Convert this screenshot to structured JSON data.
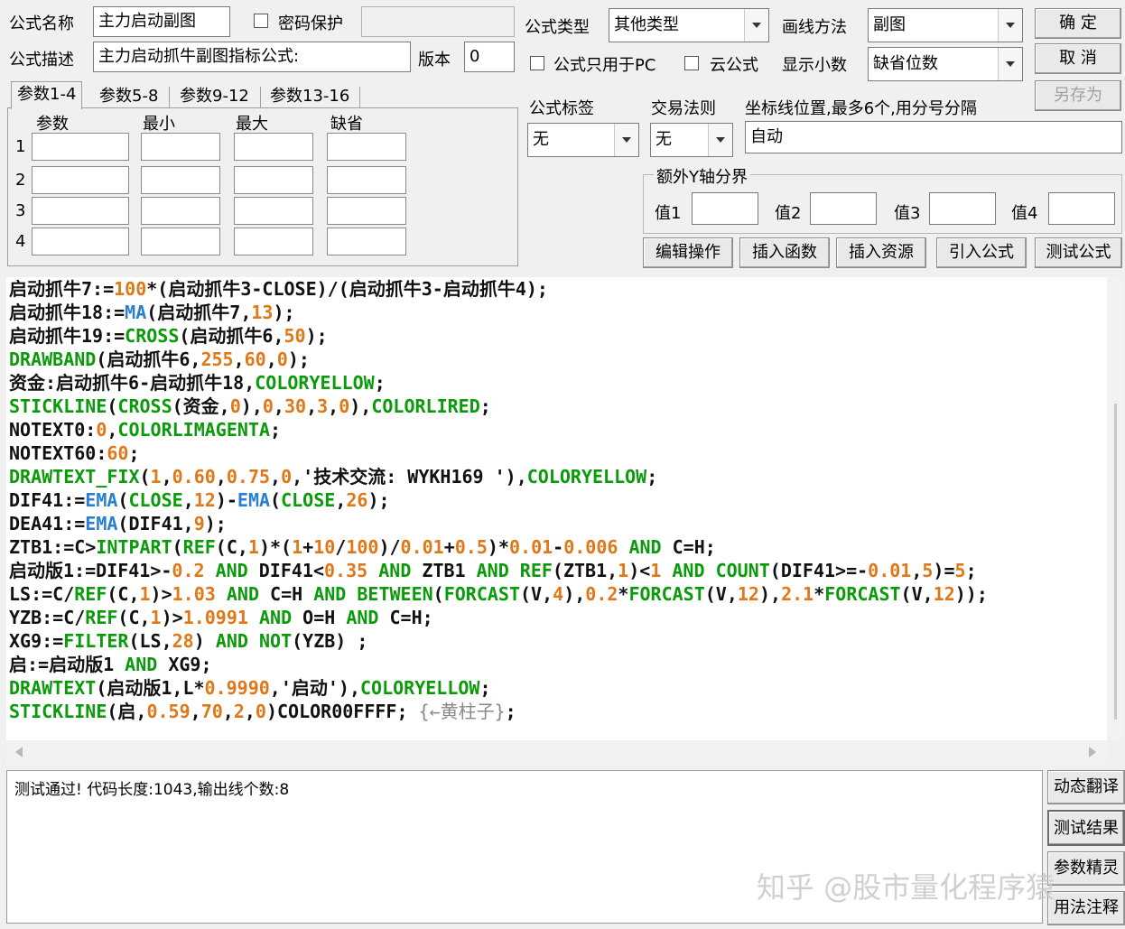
{
  "top": {
    "name_label": "公式名称",
    "name_value": "主力启动副图",
    "password_label": "密码保护",
    "desc_label": "公式描述",
    "desc_value": "主力启动抓牛副图指标公式:",
    "version_label": "版本",
    "version_value": "0",
    "type_label": "公式类型",
    "type_value": "其他类型",
    "draw_label": "画线方法",
    "draw_value": "副图",
    "pc_only_label": "公式只用于PC",
    "cloud_label": "云公式",
    "decimal_label": "显示小数",
    "decimal_value": "缺省位数",
    "ok_button": "确 定",
    "cancel_button": "取 消",
    "saveas_button": "另存为"
  },
  "tabs": [
    "参数1-4",
    "参数5-8",
    "参数9-12",
    "参数13-16"
  ],
  "params": {
    "headers": [
      "参数",
      "最小",
      "最大",
      "缺省"
    ],
    "rows": [
      "1",
      "2",
      "3",
      "4"
    ]
  },
  "right": {
    "tag_label": "公式标签",
    "tag_value": "无",
    "rule_label": "交易法则",
    "rule_value": "无",
    "axis_label": "坐标线位置,最多6个,用分号分隔",
    "axis_value": "自动",
    "yaxis_group": "额外Y轴分界",
    "v1": "值1",
    "v2": "值2",
    "v3": "值3",
    "v4": "值4"
  },
  "actions": [
    "编辑操作",
    "插入函数",
    "插入资源",
    "引入公式",
    "测试公式"
  ],
  "code": [
    [
      [
        "k",
        "启动抓牛7:="
      ],
      [
        "o",
        "100"
      ],
      [
        "k",
        "*(启动抓牛3-CLOSE)/(启动抓牛3-启动抓牛4);"
      ]
    ],
    [
      [
        "k",
        "启动抓牛18:="
      ],
      [
        "b",
        "MA"
      ],
      [
        "k",
        "(启动抓牛7,"
      ],
      [
        "o",
        "13"
      ],
      [
        "k",
        ");"
      ]
    ],
    [
      [
        "k",
        "启动抓牛19:="
      ],
      [
        "g",
        "CROSS"
      ],
      [
        "k",
        "(启动抓牛6,"
      ],
      [
        "o",
        "50"
      ],
      [
        "k",
        ");"
      ]
    ],
    [
      [
        "g",
        "DRAWBAND"
      ],
      [
        "k",
        "(启动抓牛6,"
      ],
      [
        "o",
        "255"
      ],
      [
        "k",
        ","
      ],
      [
        "o",
        "60"
      ],
      [
        "k",
        ","
      ],
      [
        "o",
        "0"
      ],
      [
        "k",
        ");"
      ]
    ],
    [
      [
        "k",
        "资金:启动抓牛6-启动抓牛18,"
      ],
      [
        "g",
        "COLORYELLOW"
      ],
      [
        "k",
        ";"
      ]
    ],
    [
      [
        "g",
        "STICKLINE"
      ],
      [
        "k",
        "("
      ],
      [
        "g",
        "CROSS"
      ],
      [
        "k",
        "(资金,"
      ],
      [
        "o",
        "0"
      ],
      [
        "k",
        "),"
      ],
      [
        "o",
        "0"
      ],
      [
        "k",
        ","
      ],
      [
        "o",
        "30"
      ],
      [
        "k",
        ","
      ],
      [
        "o",
        "3"
      ],
      [
        "k",
        ","
      ],
      [
        "o",
        "0"
      ],
      [
        "k",
        "),"
      ],
      [
        "g",
        "COLORLIRED"
      ],
      [
        "k",
        ";"
      ]
    ],
    [
      [
        "k",
        "NOTEXT0:"
      ],
      [
        "o",
        "0"
      ],
      [
        "k",
        ","
      ],
      [
        "g",
        "COLORLIMAGENTA"
      ],
      [
        "k",
        ";"
      ]
    ],
    [
      [
        "k",
        "NOTEXT60:"
      ],
      [
        "o",
        "60"
      ],
      [
        "k",
        ";"
      ]
    ],
    [
      [
        "g",
        "DRAWTEXT_FIX"
      ],
      [
        "k",
        "("
      ],
      [
        "o",
        "1"
      ],
      [
        "k",
        ","
      ],
      [
        "o",
        "0.60"
      ],
      [
        "k",
        ","
      ],
      [
        "o",
        "0.75"
      ],
      [
        "k",
        ","
      ],
      [
        "o",
        "0"
      ],
      [
        "k",
        ",'技术交流: WYKH169 '),"
      ],
      [
        "g",
        "COLORYELLOW"
      ],
      [
        "k",
        ";"
      ]
    ],
    [
      [
        "k",
        "DIF41:="
      ],
      [
        "b",
        "EMA"
      ],
      [
        "k",
        "("
      ],
      [
        "g",
        "CLOSE"
      ],
      [
        "k",
        ","
      ],
      [
        "o",
        "12"
      ],
      [
        "k",
        ")-"
      ],
      [
        "b",
        "EMA"
      ],
      [
        "k",
        "("
      ],
      [
        "g",
        "CLOSE"
      ],
      [
        "k",
        ","
      ],
      [
        "o",
        "26"
      ],
      [
        "k",
        ");"
      ]
    ],
    [
      [
        "k",
        "DEA41:="
      ],
      [
        "b",
        "EMA"
      ],
      [
        "k",
        "(DIF41,"
      ],
      [
        "o",
        "9"
      ],
      [
        "k",
        ");"
      ]
    ],
    [
      [
        "k",
        "ZTB1:=C>"
      ],
      [
        "g",
        "INTPART"
      ],
      [
        "k",
        "("
      ],
      [
        "g",
        "REF"
      ],
      [
        "k",
        "(C,"
      ],
      [
        "o",
        "1"
      ],
      [
        "k",
        ")*("
      ],
      [
        "o",
        "1"
      ],
      [
        "k",
        "+"
      ],
      [
        "o",
        "10"
      ],
      [
        "k",
        "/"
      ],
      [
        "o",
        "100"
      ],
      [
        "k",
        ")/"
      ],
      [
        "o",
        "0.01"
      ],
      [
        "k",
        "+"
      ],
      [
        "o",
        "0.5"
      ],
      [
        "k",
        ")*"
      ],
      [
        "o",
        "0.01"
      ],
      [
        "k",
        "-"
      ],
      [
        "o",
        "0.006"
      ],
      [
        "k",
        " "
      ],
      [
        "g",
        "AND"
      ],
      [
        "k",
        " C=H;"
      ]
    ],
    [
      [
        "k",
        "启动版1:=DIF41>-"
      ],
      [
        "o",
        "0.2"
      ],
      [
        "k",
        " "
      ],
      [
        "g",
        "AND"
      ],
      [
        "k",
        " DIF41<"
      ],
      [
        "o",
        "0.35"
      ],
      [
        "k",
        " "
      ],
      [
        "g",
        "AND"
      ],
      [
        "k",
        " ZTB1 "
      ],
      [
        "g",
        "AND"
      ],
      [
        "k",
        " "
      ],
      [
        "g",
        "REF"
      ],
      [
        "k",
        "(ZTB1,"
      ],
      [
        "o",
        "1"
      ],
      [
        "k",
        ")<"
      ],
      [
        "o",
        "1"
      ],
      [
        "k",
        " "
      ],
      [
        "g",
        "AND"
      ],
      [
        "k",
        " "
      ],
      [
        "g",
        "COUNT"
      ],
      [
        "k",
        "(DIF41>=-"
      ],
      [
        "o",
        "0.01"
      ],
      [
        "k",
        ","
      ],
      [
        "o",
        "5"
      ],
      [
        "k",
        ")="
      ],
      [
        "o",
        "5"
      ],
      [
        "k",
        ";"
      ]
    ],
    [
      [
        "k",
        "LS:=C/"
      ],
      [
        "g",
        "REF"
      ],
      [
        "k",
        "(C,"
      ],
      [
        "o",
        "1"
      ],
      [
        "k",
        ")>"
      ],
      [
        "o",
        "1.03"
      ],
      [
        "k",
        " "
      ],
      [
        "g",
        "AND"
      ],
      [
        "k",
        " C=H "
      ],
      [
        "g",
        "AND"
      ],
      [
        "k",
        " "
      ],
      [
        "g",
        "BETWEEN"
      ],
      [
        "k",
        "("
      ],
      [
        "g",
        "FORCAST"
      ],
      [
        "k",
        "(V,"
      ],
      [
        "o",
        "4"
      ],
      [
        "k",
        "),"
      ],
      [
        "o",
        "0.2"
      ],
      [
        "k",
        "*"
      ],
      [
        "g",
        "FORCAST"
      ],
      [
        "k",
        "(V,"
      ],
      [
        "o",
        "12"
      ],
      [
        "k",
        "),"
      ],
      [
        "o",
        "2.1"
      ],
      [
        "k",
        "*"
      ],
      [
        "g",
        "FORCAST"
      ],
      [
        "k",
        "(V,"
      ],
      [
        "o",
        "12"
      ],
      [
        "k",
        "));"
      ]
    ],
    [
      [
        "k",
        "YZB:=C/"
      ],
      [
        "g",
        "REF"
      ],
      [
        "k",
        "(C,"
      ],
      [
        "o",
        "1"
      ],
      [
        "k",
        ")>"
      ],
      [
        "o",
        "1.0991"
      ],
      [
        "k",
        " "
      ],
      [
        "g",
        "AND"
      ],
      [
        "k",
        " O=H "
      ],
      [
        "g",
        "AND"
      ],
      [
        "k",
        " C=H;"
      ]
    ],
    [
      [
        "k",
        "XG9:="
      ],
      [
        "g",
        "FILTER"
      ],
      [
        "k",
        "(LS,"
      ],
      [
        "o",
        "28"
      ],
      [
        "k",
        ") "
      ],
      [
        "g",
        "AND"
      ],
      [
        "k",
        " "
      ],
      [
        "g",
        "NOT"
      ],
      [
        "k",
        "(YZB) ;"
      ]
    ],
    [
      [
        "k",
        "启:=启动版1 "
      ],
      [
        "g",
        "AND"
      ],
      [
        "k",
        " XG9;"
      ]
    ],
    [
      [
        "g",
        "DRAWTEXT"
      ],
      [
        "k",
        "(启动版1,L*"
      ],
      [
        "o",
        "0.9990"
      ],
      [
        "k",
        ",'启动'),"
      ],
      [
        "g",
        "COLORYELLOW"
      ],
      [
        "k",
        ";"
      ]
    ],
    [
      [
        "g",
        "STICKLINE"
      ],
      [
        "k",
        "(启,"
      ],
      [
        "o",
        "0.59"
      ],
      [
        "k",
        ","
      ],
      [
        "o",
        "70"
      ],
      [
        "k",
        ","
      ],
      [
        "o",
        "2"
      ],
      [
        "k",
        ","
      ],
      [
        "o",
        "0"
      ],
      [
        "k",
        ")COLOR00FFFF; "
      ],
      [
        "gr",
        "{←黄柱子}"
      ],
      [
        "k",
        ";"
      ]
    ]
  ],
  "output_text": "测试通过! 代码长度:1043,输出线个数:8",
  "side_buttons": [
    "动态翻译",
    "测试结果",
    "参数精灵",
    "用法注释"
  ],
  "watermark": "知乎 @股市量化程序猿"
}
